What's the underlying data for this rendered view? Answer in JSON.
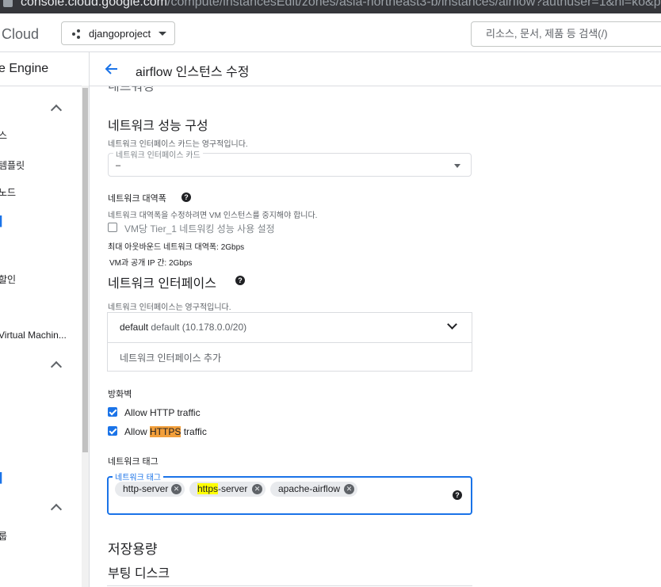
{
  "browser": {
    "url_prefix": "console.cloud.google.com",
    "url_rest": "/compute/instancesEdit/zones/asia-northeast3-b/instances/airflow?authuser=1&hl=ko&project=djang"
  },
  "header": {
    "brand": "Cloud",
    "project_name": "djangoproject",
    "search_placeholder": "리소스, 문서, 제품 등 검색(/)"
  },
  "sidebar": {
    "title": "e Engine",
    "items": [
      {
        "label": "스"
      },
      {
        "label": "템플릿"
      },
      {
        "label": "노드"
      },
      {
        "label": "할인"
      },
      {
        "label": "Virtual Machin..."
      },
      {
        "label": "룹"
      }
    ]
  },
  "page": {
    "title": "airflow 인스턴스 수정",
    "partial_heading": "네트워킹"
  },
  "network_perf": {
    "heading": "네트워크 성능 구성",
    "hint": "네트워크 인터페이스 카드는 영구적입니다.",
    "nic_label": "네트워크 인터페이스 카드",
    "nic_value": "–"
  },
  "bandwidth": {
    "label": "네트워크 대역폭",
    "hint": "네트워크 대역폭을 수정하려면 VM 인스턴스를 중지해야 합니다.",
    "tier1_label": "VM당 Tier_1 네트워킹 성능 사용 설정",
    "max_outbound": "최대 아웃바운드 네트워크 대역폭: 2Gbps",
    "vm_to_ip": "VM과 공개 IP 간: 2Gbps"
  },
  "interfaces": {
    "heading": "네트워크 인터페이스",
    "hint": "네트워크 인터페이스는 영구적입니다.",
    "iface_name": "default",
    "iface_detail": "default (10.178.0.0/20)",
    "add_label": "네트워크 인터페이스 추가"
  },
  "firewall": {
    "heading": "방화벽",
    "http_label": "Allow HTTP traffic",
    "https_prefix": "Allow ",
    "https_highlight": "HTTPS",
    "https_suffix": " traffic"
  },
  "tags": {
    "heading": "네트워크 태그",
    "field_label": "네트워크 태그",
    "chips": [
      {
        "before": "http-server",
        "hl": "",
        "after": ""
      },
      {
        "before": "",
        "hl": "https",
        "after": "-server"
      },
      {
        "before": "apache-airflow",
        "hl": "",
        "after": ""
      }
    ]
  },
  "storage": {
    "heading": "저장용량",
    "boot_disk": "부팅 디스크"
  }
}
